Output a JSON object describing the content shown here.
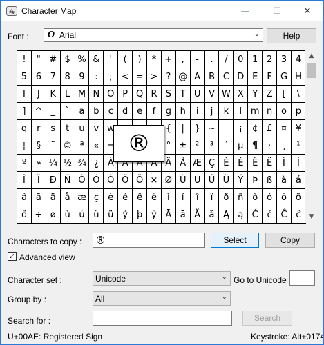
{
  "window": {
    "title": "Character Map",
    "app_icon_glyph": "₳",
    "minimize_glyph": "—",
    "maximize_glyph": "☐",
    "close_glyph": "✕"
  },
  "font": {
    "label": "Font :",
    "icon_glyph": "O",
    "value": "Arial",
    "help_label": "Help"
  },
  "grid": {
    "rows": [
      [
        "!",
        "\"",
        "#",
        "$",
        "%",
        "&",
        "'",
        "(",
        ")",
        "*",
        "+",
        ",",
        "-",
        ".",
        "/",
        "0",
        "1",
        "2",
        "3",
        "4"
      ],
      [
        "5",
        "6",
        "7",
        "8",
        "9",
        ":",
        ";",
        "<",
        "=",
        ">",
        "?",
        "@",
        "A",
        "B",
        "C",
        "D",
        "E",
        "F",
        "G",
        "H"
      ],
      [
        "I",
        "J",
        "K",
        "L",
        "M",
        "N",
        "O",
        "P",
        "Q",
        "R",
        "S",
        "T",
        "U",
        "V",
        "W",
        "X",
        "Y",
        "Z",
        "[",
        "\\"
      ],
      [
        "]",
        "^",
        "_",
        "`",
        "a",
        "b",
        "c",
        "d",
        "e",
        "f",
        "g",
        "h",
        "i",
        "j",
        "k",
        "l",
        "m",
        "n",
        "o",
        "p"
      ],
      [
        "q",
        "r",
        "s",
        "t",
        "u",
        "v",
        "w",
        "x",
        "y",
        "z",
        "{",
        "|",
        "}",
        "~",
        " ",
        "¡",
        "¢",
        "£",
        "¤",
        "¥"
      ],
      [
        "¦",
        "§",
        "¨",
        "©",
        "ª",
        "«",
        "¬",
        "­",
        "®",
        "¯",
        "°",
        "±",
        "²",
        "³",
        "´",
        "µ",
        "¶",
        "·",
        "¸",
        "¹"
      ],
      [
        "º",
        "»",
        "¼",
        "½",
        "¾",
        "¿",
        "À",
        "Á",
        "Â",
        "Ã",
        "Ä",
        "Å",
        "Æ",
        "Ç",
        "È",
        "É",
        "Ê",
        "Ë",
        "Ì",
        "Í"
      ],
      [
        "Î",
        "Ï",
        "Ð",
        "Ñ",
        "Ò",
        "Ó",
        "Ô",
        "Õ",
        "Ö",
        "×",
        "Ø",
        "Ù",
        "Ú",
        "Û",
        "Ü",
        "Ý",
        "Þ",
        "ß",
        "à",
        "á"
      ],
      [
        "â",
        "ã",
        "ä",
        "å",
        "æ",
        "ç",
        "è",
        "é",
        "ê",
        "ë",
        "ì",
        "í",
        "î",
        "ï",
        "ð",
        "ñ",
        "ò",
        "ó",
        "ô",
        "õ"
      ],
      [
        "ö",
        "÷",
        "ø",
        "ù",
        "ú",
        "û",
        "ü",
        "ý",
        "þ",
        "ÿ",
        "Ā",
        "ā",
        "Ă",
        "ă",
        "Ą",
        "ą",
        "Ć",
        "ć",
        "Ĉ",
        "ĉ"
      ]
    ],
    "selected_glyph": "®",
    "scroll_up_glyph": "▲",
    "scroll_down_glyph": "▼"
  },
  "copy": {
    "label": "Characters to copy :",
    "value": "®",
    "select_label": "Select",
    "copy_label": "Copy"
  },
  "advanced": {
    "label": "Advanced view",
    "checked_glyph": "✓"
  },
  "charset": {
    "label": "Character set :",
    "value": "Unicode",
    "goto_label": "Go to Unicode :",
    "goto_value": ""
  },
  "group": {
    "label": "Group by :",
    "value": "All"
  },
  "search": {
    "label": "Search for :",
    "value": "",
    "button_label": "Search"
  },
  "dropdown_glyph": "⌄",
  "status": {
    "left": "U+00AE: Registered Sign",
    "right": "Keystroke: Alt+0174"
  }
}
